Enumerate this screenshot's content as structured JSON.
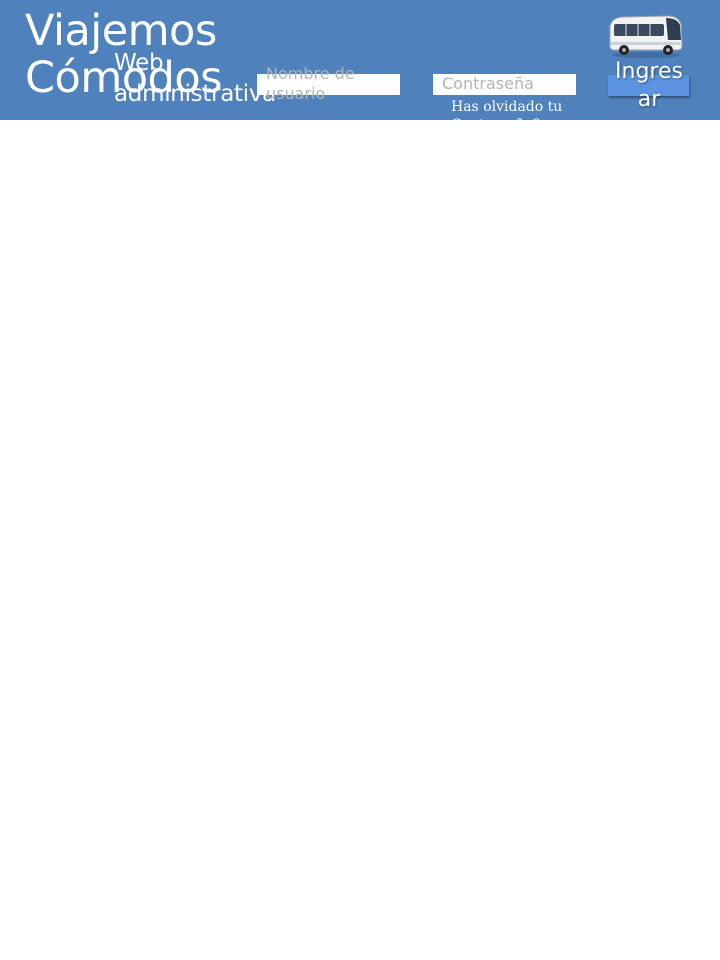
{
  "header": {
    "brand_title": "Viajemos Cómodos",
    "brand_subtitle": "Web administrativa",
    "logo_icon": "bus-icon",
    "background_color": "#4f81bd"
  },
  "login": {
    "username_placeholder": "Nombre de usuario",
    "password_placeholder": "Contraseña",
    "forgot_password_link": "Has olvidado tu Contraseña?",
    "submit_label": "Ingresar",
    "button_color": "#5b93e0"
  }
}
